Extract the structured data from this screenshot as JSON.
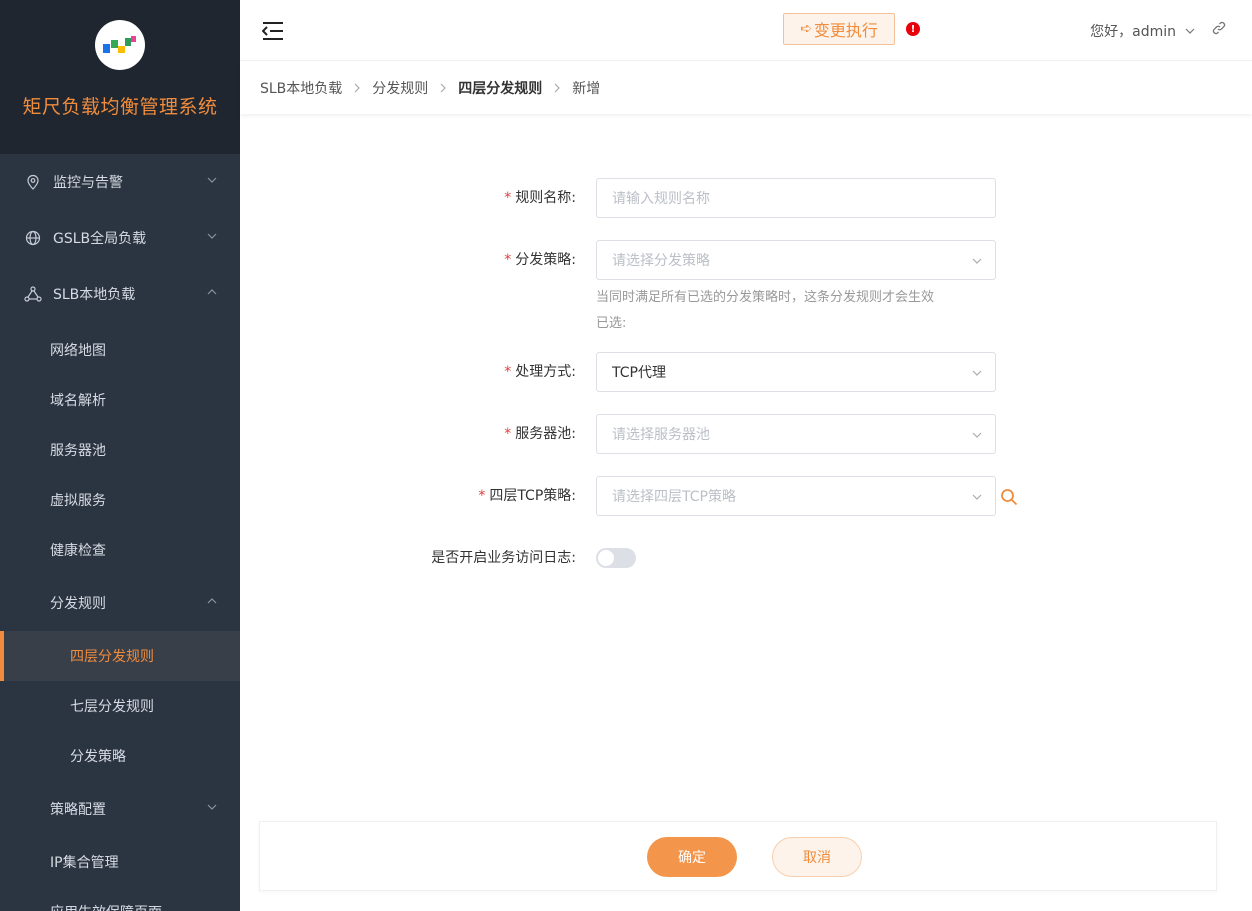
{
  "app": {
    "title": "矩尺负载均衡管理系统"
  },
  "sidebar": {
    "menu": [
      {
        "label": "监控与告警",
        "icon": "location-pin-icon"
      },
      {
        "label": "GSLB全局负载",
        "icon": "globe-icon"
      },
      {
        "label": "SLB本地负载",
        "icon": "network-nodes-icon"
      }
    ],
    "slb_children": [
      "网络地图",
      "域名解析",
      "服务器池",
      "虚拟服务",
      "健康检查"
    ],
    "dispatch_rules": {
      "label": "分发规则",
      "children": [
        "四层分发规则",
        "七层分发规则",
        "分发策略"
      ]
    },
    "after": [
      "策略配置",
      "IP集合管理",
      "应用生效保障页面"
    ]
  },
  "header": {
    "exec_button": "变更执行",
    "alert_mark": "!",
    "greeting": "您好，admin"
  },
  "breadcrumb": [
    "SLB本地负载",
    "分发规则",
    "四层分发规则",
    "新增"
  ],
  "form": {
    "rule_name": {
      "label": "规则名称:",
      "placeholder": "请输入规则名称"
    },
    "strategy": {
      "label": "分发策略:",
      "placeholder": "请选择分发策略",
      "hint": "当同时满足所有已选的分发策略时，这条分发规则才会生效",
      "selected_label": "已选:"
    },
    "mode": {
      "label": "处理方式:",
      "value": "TCP代理"
    },
    "pool": {
      "label": "服务器池:",
      "placeholder": "请选择服务器池"
    },
    "tcp_policy": {
      "label": "四层TCP策略:",
      "placeholder": "请选择四层TCP策略"
    },
    "access_log": {
      "label": "是否开启业务访问日志:",
      "enabled": false
    }
  },
  "footer": {
    "confirm": "确定",
    "cancel": "取消"
  },
  "colors": {
    "accent": "#f08c3c",
    "sidebar_bg": "#2b3441",
    "required": "#e23c39"
  }
}
